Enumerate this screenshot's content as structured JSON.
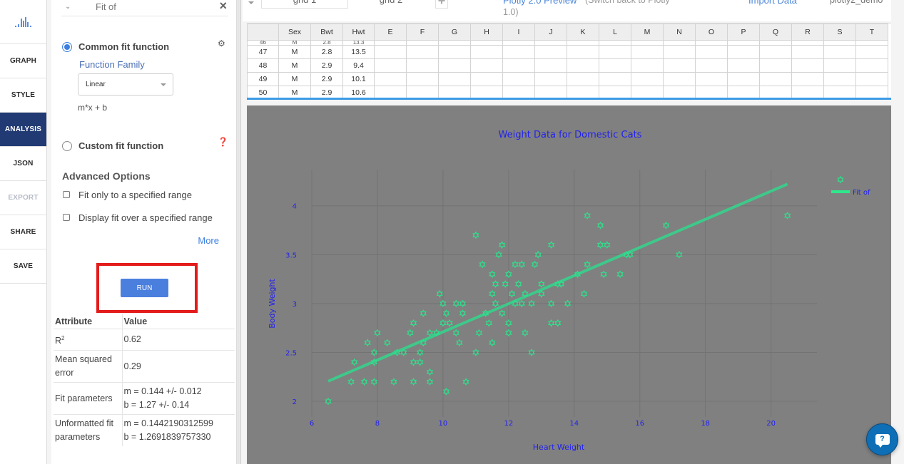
{
  "nav": {
    "items": [
      {
        "label": "GRAPH",
        "state": "normal"
      },
      {
        "label": "STYLE",
        "state": "normal"
      },
      {
        "label": "ANALYSIS",
        "state": "active"
      },
      {
        "label": "JSON",
        "state": "normal"
      },
      {
        "label": "EXPORT",
        "state": "disabled"
      },
      {
        "label": "SHARE",
        "state": "normal"
      },
      {
        "label": "SAVE",
        "state": "normal"
      }
    ],
    "logo_icon": "plotly-bars-icon"
  },
  "panel": {
    "header_title": "Fit of",
    "common_fit_label": "Common fit function",
    "common_fit_selected": true,
    "function_family_label": "Function Family",
    "function_family_value": "Linear",
    "formula": "m*x + b",
    "custom_fit_label": "Custom fit function",
    "custom_fit_selected": false,
    "advanced_title": "Advanced Options",
    "options": [
      {
        "label": "Fit only to a specified range",
        "checked": false
      },
      {
        "label": "Display fit over a specified range",
        "checked": false
      }
    ],
    "more_label": "More",
    "run_label": "RUN",
    "results": {
      "headers": [
        "Attribute",
        "Value"
      ],
      "r2_label": "R",
      "r2_sup": "2",
      "r2_value": "0.62",
      "mse_label": "Mean squared error",
      "mse_value": "0.29",
      "fit_params_label": "Fit parameters",
      "fit_m": "m = 0.144 +/- 0.012",
      "fit_b": "b = 1.27 +/- 0.14",
      "unformatted_label": "Unformatted fit parameters",
      "unf_m": "m = 0.1442190312599",
      "unf_b": "b = 1.2691839757330"
    }
  },
  "topbar": {
    "tabs": [
      "grid 1",
      "grid 2"
    ],
    "add_tab": "+",
    "preview_link": "Plotly 2.0 Preview",
    "switch_back": "(Switch back to Plotly",
    "switch_back_2": "1.0)",
    "import_data": "Import Data",
    "username": "plotly2_demo"
  },
  "grid": {
    "columns": [
      "",
      "Sex",
      "Bwt",
      "Hwt",
      "E",
      "F",
      "G",
      "H",
      "I",
      "J",
      "K",
      "L",
      "M",
      "N",
      "O",
      "P",
      "Q",
      "R",
      "S",
      "T"
    ],
    "clipped_row": [
      "46",
      "M",
      "2.8",
      "13.3"
    ],
    "rows": [
      [
        "47",
        "M",
        "2.8",
        "13.5"
      ],
      [
        "48",
        "M",
        "2.9",
        "9.4"
      ],
      [
        "49",
        "M",
        "2.9",
        "10.1"
      ],
      [
        "50",
        "M",
        "2.9",
        "10.6"
      ]
    ]
  },
  "chart_data": {
    "type": "scatter",
    "title": "Weight Data for Domestic Cats",
    "xlabel": "Heart Weight",
    "ylabel": "Body Weight",
    "xlim": [
      6,
      21.4
    ],
    "ylim": [
      1.84,
      4.37
    ],
    "xticks": [
      6,
      8,
      10,
      12,
      14,
      16,
      18,
      20
    ],
    "yticks": [
      2,
      2.5,
      3,
      3.5,
      4
    ],
    "grid": true,
    "legend_position": "top-right",
    "colors": {
      "background": "#808080",
      "marker": "#2ee08c",
      "fit_line": "#3ec98a",
      "text": "#2222ee",
      "gridline": "#737373"
    },
    "series": [
      {
        "name": "",
        "mode": "markers",
        "marker_symbol": "hexagram-open",
        "points": [
          [
            6.5,
            2.0
          ],
          [
            10.1,
            2.1
          ],
          [
            7.2,
            2.2
          ],
          [
            7.6,
            2.2
          ],
          [
            7.9,
            2.2
          ],
          [
            8.5,
            2.2
          ],
          [
            9.1,
            2.2
          ],
          [
            9.6,
            2.2
          ],
          [
            10.7,
            2.2
          ],
          [
            9.6,
            2.3
          ],
          [
            7.3,
            2.4
          ],
          [
            7.9,
            2.4
          ],
          [
            9.1,
            2.4
          ],
          [
            9.3,
            2.4
          ],
          [
            7.9,
            2.5
          ],
          [
            8.6,
            2.5
          ],
          [
            8.8,
            2.5
          ],
          [
            9.3,
            2.5
          ],
          [
            11.0,
            2.5
          ],
          [
            12.7,
            2.5
          ],
          [
            7.7,
            2.6
          ],
          [
            8.3,
            2.6
          ],
          [
            9.4,
            2.6
          ],
          [
            10.5,
            2.6
          ],
          [
            11.5,
            2.6
          ],
          [
            8.0,
            2.7
          ],
          [
            9.0,
            2.7
          ],
          [
            9.6,
            2.7
          ],
          [
            9.8,
            2.7
          ],
          [
            10.4,
            2.7
          ],
          [
            11.1,
            2.7
          ],
          [
            12.0,
            2.7
          ],
          [
            12.5,
            2.7
          ],
          [
            9.1,
            2.8
          ],
          [
            10.0,
            2.8
          ],
          [
            10.2,
            2.8
          ],
          [
            11.4,
            2.8
          ],
          [
            12.0,
            2.8
          ],
          [
            13.3,
            2.8
          ],
          [
            13.5,
            2.8
          ],
          [
            9.4,
            2.9
          ],
          [
            10.1,
            2.9
          ],
          [
            10.6,
            2.9
          ],
          [
            11.3,
            2.9
          ],
          [
            11.8,
            2.9
          ],
          [
            10.0,
            3.0
          ],
          [
            10.4,
            3.0
          ],
          [
            10.6,
            3.0
          ],
          [
            11.6,
            3.0
          ],
          [
            12.2,
            3.0
          ],
          [
            12.4,
            3.0
          ],
          [
            12.7,
            3.0
          ],
          [
            13.3,
            3.0
          ],
          [
            13.8,
            3.0
          ],
          [
            9.9,
            3.1
          ],
          [
            11.5,
            3.1
          ],
          [
            12.1,
            3.1
          ],
          [
            12.5,
            3.1
          ],
          [
            13.0,
            3.1
          ],
          [
            14.3,
            3.1
          ],
          [
            11.6,
            3.2
          ],
          [
            11.9,
            3.2
          ],
          [
            12.3,
            3.2
          ],
          [
            13.0,
            3.2
          ],
          [
            13.5,
            3.2
          ],
          [
            13.6,
            3.2
          ],
          [
            11.5,
            3.3
          ],
          [
            12.0,
            3.3
          ],
          [
            14.1,
            3.3
          ],
          [
            14.9,
            3.3
          ],
          [
            15.4,
            3.3
          ],
          [
            11.2,
            3.4
          ],
          [
            12.2,
            3.4
          ],
          [
            12.4,
            3.4
          ],
          [
            12.8,
            3.4
          ],
          [
            14.4,
            3.4
          ],
          [
            11.7,
            3.5
          ],
          [
            12.9,
            3.5
          ],
          [
            15.6,
            3.5
          ],
          [
            15.7,
            3.5
          ],
          [
            17.2,
            3.5
          ],
          [
            11.8,
            3.6
          ],
          [
            13.3,
            3.6
          ],
          [
            14.8,
            3.6
          ],
          [
            15.0,
            3.6
          ],
          [
            11.0,
            3.7
          ],
          [
            14.8,
            3.8
          ],
          [
            16.8,
            3.8
          ],
          [
            14.4,
            3.9
          ],
          [
            20.5,
            3.9
          ]
        ]
      },
      {
        "name": "Fit of",
        "mode": "lines",
        "slope": 0.144,
        "intercept": 1.27,
        "x_range": [
          6.5,
          20.5
        ]
      }
    ]
  },
  "help_button_icon": "help-chat-icon"
}
